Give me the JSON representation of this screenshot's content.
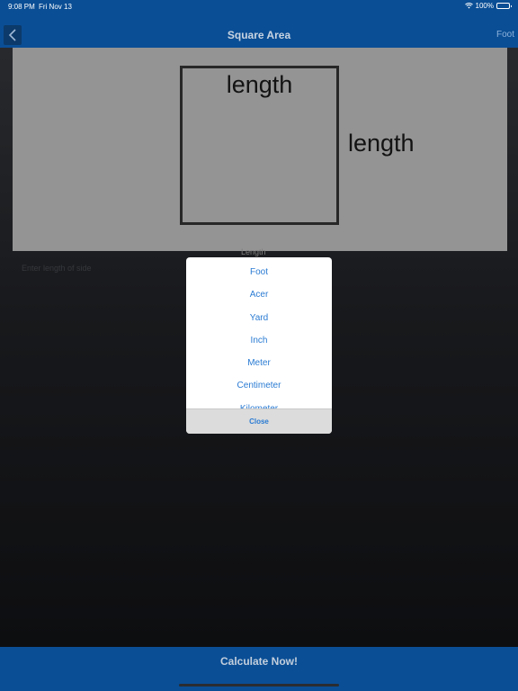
{
  "status_bar": {
    "time": "9:08 PM",
    "date": "Fri Nov 13",
    "battery": "100%",
    "battery_level": 1.0
  },
  "nav": {
    "title": "Square Area",
    "unit_button": "Foot",
    "back_icon": "chevron-left-icon"
  },
  "diagram": {
    "top_label": "length",
    "side_label": "length"
  },
  "input": {
    "caption": "Length",
    "placeholder": "Enter length of side"
  },
  "picker": {
    "options": [
      "Foot",
      "Acer",
      "Yard",
      "Inch",
      "Meter",
      "Centimeter",
      "Kilometer"
    ],
    "close_label": "Close"
  },
  "footer": {
    "calculate_label": "Calculate Now!"
  },
  "colors": {
    "brand": "#0a4e95",
    "link": "#2a7bd3"
  }
}
